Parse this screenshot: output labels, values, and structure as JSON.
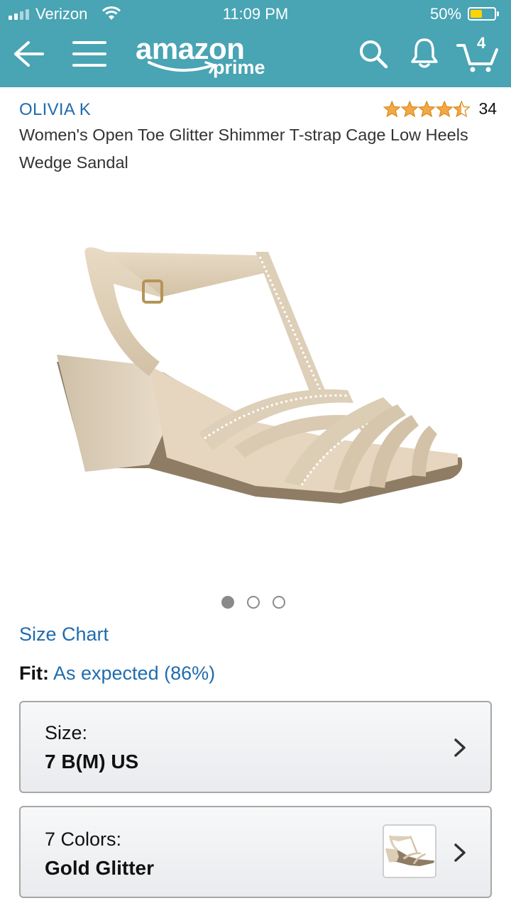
{
  "status_bar": {
    "carrier": "Verizon",
    "time": "11:09 PM",
    "battery_percent": "50%",
    "battery_level": 0.5
  },
  "header": {
    "logo_text": "amazon",
    "logo_sub": "prime",
    "cart_count": "4",
    "accent_color": "#49a4b4",
    "icons": [
      "back-arrow-icon",
      "menu-icon",
      "search-icon",
      "bell-icon",
      "cart-icon"
    ]
  },
  "product": {
    "brand": "OLIVIA K",
    "rating": 4.5,
    "review_count": "34",
    "title": "Women's Open Toe Glitter Shimmer T-strap Cage Low Heels Wedge Sandal",
    "image_count": 3,
    "active_image": 1
  },
  "size_chart_label": "Size Chart",
  "fit": {
    "label": "Fit:",
    "value": "As expected (86%)"
  },
  "size_selector": {
    "label": "Size:",
    "value": "7 B(M) US"
  },
  "color_selector": {
    "label": "7 Colors:",
    "value": "Gold Glitter"
  }
}
